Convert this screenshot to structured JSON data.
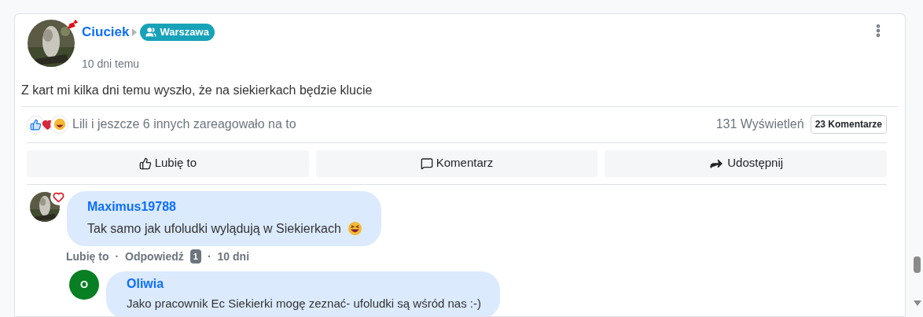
{
  "post": {
    "author": "Ciuciek",
    "group": "Warszawa",
    "time": "10 dni temu",
    "text": "Z kart mi kilka dni temu wyszło, że na siekierkach będzie klucie",
    "reactions_summary": "Lili i jeszcze 6 innych zareagowało na to",
    "views": "131 Wyświetleń",
    "comments_count": "23 Komentarze",
    "actions": [
      {
        "kind": "like",
        "label": "Lubię to"
      },
      {
        "kind": "comment",
        "label": "Komentarz"
      },
      {
        "kind": "share",
        "label": "Udostępnij"
      }
    ]
  },
  "comments": [
    {
      "author": "Maximus19788",
      "text": "Tak samo jak ufoludki wylądują w Siekierkach",
      "like": "Lubię to",
      "separator_1": "·",
      "reply": "Odpowiedź",
      "reply_count": "1",
      "separator_2": "·",
      "time": "10 dni",
      "replies": [
        {
          "author": "Oliwia",
          "initial": "O",
          "color": "#087f23",
          "text": "Jako pracownik Ec Siekierki mogę zeznać- ufoludki są wśród nas :-)"
        }
      ]
    }
  ]
}
